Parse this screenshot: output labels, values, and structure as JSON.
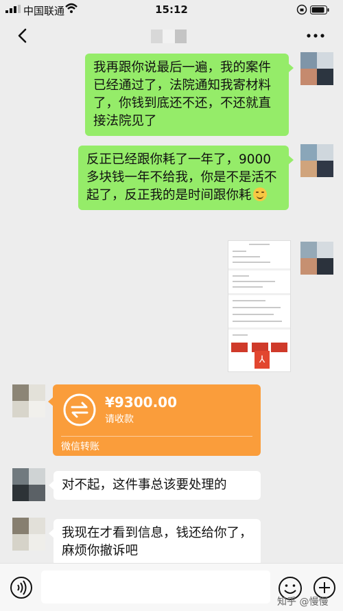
{
  "status_bar": {
    "carrier": "中国联通",
    "time": "15:12"
  },
  "nav": {
    "icons": [
      "back-icon",
      "more-icon"
    ]
  },
  "messages": [
    {
      "side": "right",
      "type": "text",
      "text": "我再跟你说最后一遍，我的案件已经通过了，法院通知我寄材料了，你钱到底还不还，不还就直接法院见了"
    },
    {
      "side": "right",
      "type": "text",
      "text": "反正已经跟你耗了一年了，9000多块钱一年不给我，你是不是活不起了，反正我的是时间跟你耗",
      "emoji": "smile-emoji-icon"
    },
    {
      "side": "right",
      "type": "image"
    },
    {
      "side": "left",
      "type": "transfer",
      "amount": "¥9300.00",
      "status": "请收款",
      "footer": "微信转账"
    },
    {
      "side": "left",
      "type": "text",
      "text": "对不起，这件事总该要处理的"
    },
    {
      "side": "left",
      "type": "text",
      "text": "我现在才看到信息，钱还给你了，麻烦你撤诉吧"
    }
  ],
  "watermark": "知乎 @慢慢",
  "colors": {
    "background": "#ededed",
    "sent_bubble": "#95ec69",
    "received_bubble": "#ffffff",
    "transfer": "#fa9d3b"
  }
}
